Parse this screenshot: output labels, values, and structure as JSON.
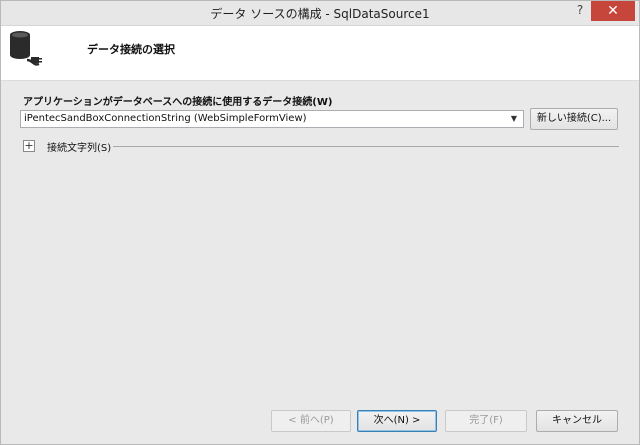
{
  "window": {
    "title": "データ ソースの構成 - SqlDataSource1",
    "help_glyph": "?",
    "close_glyph": "✕"
  },
  "header": {
    "title": "データ接続の選択",
    "icon": "database-connection-icon"
  },
  "connection": {
    "label": "アプリケーションがデータベースへの接続に使用するデータ接続(W)",
    "selected_value": "iPentecSandBoxConnectionString (WebSimpleFormView)",
    "new_connection_button": "新しい接続(C)..."
  },
  "connection_string": {
    "expander_glyph": "+",
    "label": "接続文字列(S)"
  },
  "footer": {
    "back_button": "< 前へ(P)",
    "next_button": "次へ(N) >",
    "finish_button": "完了(F)",
    "cancel_button": "キャンセル"
  }
}
